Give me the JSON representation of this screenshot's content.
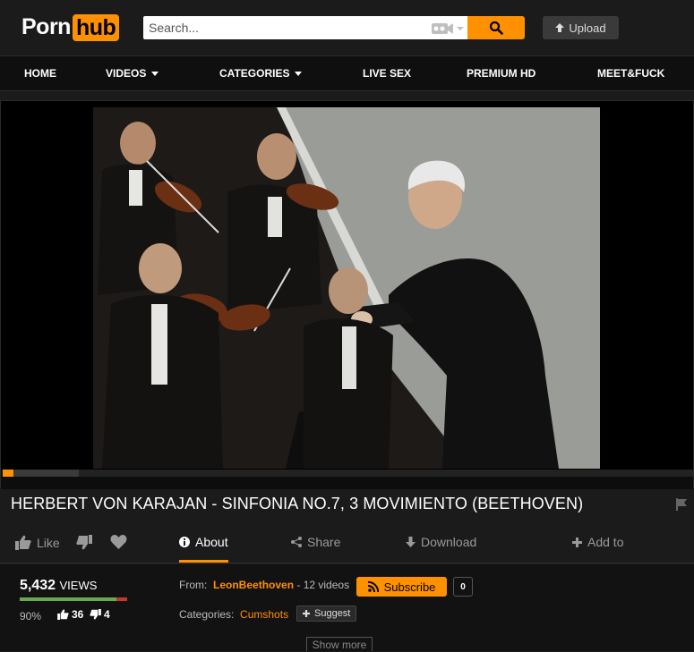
{
  "header": {
    "logo_text_1": "Porn",
    "logo_text_2": "hub",
    "search_placeholder": "Search...",
    "upload_label": "Upload"
  },
  "nav": {
    "items": [
      "HOME",
      "VIDEOS",
      "CATEGORIES",
      "LIVE SEX",
      "PREMIUM HD",
      "MEET&FUCK"
    ]
  },
  "player": {
    "progress_played": 0.015,
    "progress_buffered": 0.11
  },
  "video": {
    "title": "HERBERT VON KARAJAN - SINFONIA NO.7, 3 MOVIMIENTO (BEETHOVEN)"
  },
  "actions": {
    "like": "Like",
    "about": "About",
    "share": "Share",
    "download": "Download",
    "add_to": "Add to"
  },
  "stats": {
    "views_count": "5,432",
    "views_label": "VIEWS",
    "rating_percent": "90%",
    "rating_fraction": 0.9,
    "thumbs_up": "36",
    "thumbs_down": "4"
  },
  "uploader": {
    "from_label": "From:",
    "name": "LeonBeethoven",
    "videos": "- 12 videos",
    "subscribe_label": "Subscribe",
    "subscriber_count": "0"
  },
  "categories": {
    "label": "Categories:",
    "items": [
      "Cumshots"
    ],
    "suggest_label": "Suggest"
  },
  "show_more": "Show more",
  "colors": {
    "accent": "#ff9000",
    "background": "#1b1b1b"
  }
}
